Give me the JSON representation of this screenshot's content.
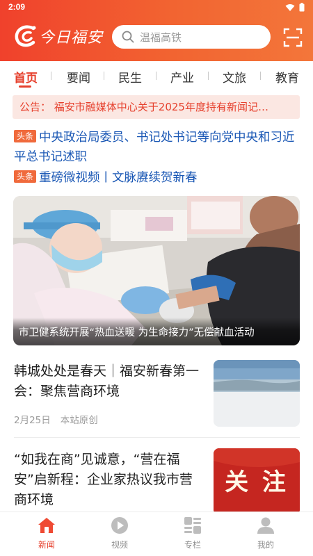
{
  "status_bar": {
    "time": "2:09"
  },
  "header": {
    "logo_text": "今日福安",
    "search_placeholder": "温福高铁",
    "colors": {
      "brand_start": "#f0412c",
      "brand_end": "#f3763a",
      "accent": "#e6402d"
    }
  },
  "tabs": [
    {
      "label": "首页",
      "active": true
    },
    {
      "label": "要闻",
      "active": false
    },
    {
      "label": "民生",
      "active": false
    },
    {
      "label": "产业",
      "active": false
    },
    {
      "label": "文旅",
      "active": false
    },
    {
      "label": "教育",
      "active": false
    }
  ],
  "notice": {
    "text": "公告：  福安市融媒体中心关于2025年度持有新闻记…"
  },
  "headlines": [
    {
      "badge": "头条",
      "text": "中央政治局委员、书记处书记等向党中央和习近平总书记述职"
    },
    {
      "badge": "头条",
      "text": "重磅微视频丨文脉赓续贺新春"
    }
  ],
  "hero": {
    "caption": "市卫健系统开展“热血送暖 为生命接力”无偿献血活动"
  },
  "articles": [
    {
      "title": "韩城处处是春天｜福安新春第一会：聚焦营商环境",
      "date": "2月25日",
      "source": "本站原创",
      "thumb": "landscape"
    },
    {
      "title": "“如我在商”见诚意，“营在福安”启新程：企业家热议我市营商环境",
      "date": "",
      "source": "",
      "thumb": "关 注"
    }
  ],
  "bottom_nav": [
    {
      "label": "新闻",
      "icon": "home-icon",
      "active": true
    },
    {
      "label": "视频",
      "icon": "play-icon",
      "active": false
    },
    {
      "label": "专栏",
      "icon": "columns-icon",
      "active": false
    },
    {
      "label": "我的",
      "icon": "user-icon",
      "active": false
    }
  ]
}
